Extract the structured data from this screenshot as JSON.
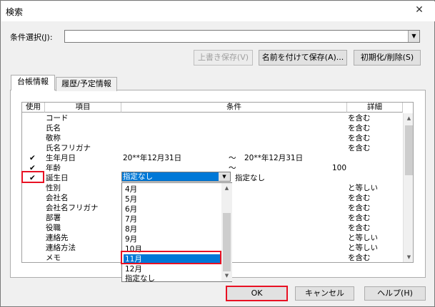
{
  "window": {
    "title": "検索",
    "close_glyph": "✕"
  },
  "conditions": {
    "label": "条件選択(J):",
    "value": ""
  },
  "toolbar": {
    "overwrite_label": "上書き保存(V)",
    "save_as_label": "名前を付けて保存(A)...",
    "reset_label": "初期化/削除(S)"
  },
  "tabs": [
    {
      "label": "台帳情報",
      "active": true
    },
    {
      "label": "履歴/予定情報",
      "active": false
    }
  ],
  "grid": {
    "columns": [
      "使用",
      "項目",
      "条件",
      "詳細"
    ],
    "rows": [
      {
        "check": "",
        "item": "コード",
        "cond1": "",
        "tilde": "",
        "cond2": "",
        "detail": "を含む"
      },
      {
        "check": "",
        "item": "氏名",
        "cond1": "",
        "tilde": "",
        "cond2": "",
        "detail": "を含む"
      },
      {
        "check": "",
        "item": "敬称",
        "cond1": "",
        "tilde": "",
        "cond2": "",
        "detail": "を含む"
      },
      {
        "check": "",
        "item": "氏名フリガナ",
        "cond1": "",
        "tilde": "",
        "cond2": "",
        "detail": "を含む"
      },
      {
        "check": "✔",
        "item": "生年月日",
        "cond1": "20**年12月31日",
        "tilde": "～",
        "cond2": "20**年12月31日",
        "detail": ""
      },
      {
        "check": "✔",
        "item": "年齢",
        "cond1": "",
        "tilde": "～",
        "cond2": "100",
        "detail": ""
      },
      {
        "check": "✔",
        "item": "誕生日",
        "cond1": "",
        "tilde": "",
        "cond2": "指定なし",
        "detail": ""
      },
      {
        "check": "",
        "item": "性別",
        "cond1": "",
        "tilde": "",
        "cond2": "",
        "detail": "と等しい"
      },
      {
        "check": "",
        "item": "会社名",
        "cond1": "",
        "tilde": "",
        "cond2": "",
        "detail": "を含む"
      },
      {
        "check": "",
        "item": "会社名フリガナ",
        "cond1": "",
        "tilde": "",
        "cond2": "",
        "detail": "を含む"
      },
      {
        "check": "",
        "item": "部署",
        "cond1": "",
        "tilde": "",
        "cond2": "",
        "detail": "を含む"
      },
      {
        "check": "",
        "item": "役職",
        "cond1": "",
        "tilde": "",
        "cond2": "",
        "detail": "を含む"
      },
      {
        "check": "",
        "item": "連絡先",
        "cond1": "",
        "tilde": "",
        "cond2": "",
        "detail": "と等しい"
      },
      {
        "check": "",
        "item": "連絡方法",
        "cond1": "",
        "tilde": "",
        "cond2": "",
        "detail": "と等しい"
      },
      {
        "check": "",
        "item": "メモ",
        "cond1": "",
        "tilde": "",
        "cond2": "",
        "detail": "を含む"
      }
    ]
  },
  "dropdown": {
    "selected": "指定なし",
    "options": [
      "4月",
      "5月",
      "6月",
      "7月",
      "8月",
      "9月",
      "10月",
      "11月",
      "12月",
      "指定なし"
    ],
    "highlighted": "11月"
  },
  "footer": {
    "ok_label": "OK",
    "cancel_label": "キャンセル",
    "help_label": "ヘルプ(H)"
  },
  "colors": {
    "highlight_red": "#e81123",
    "selection_blue": "#0078d7"
  }
}
